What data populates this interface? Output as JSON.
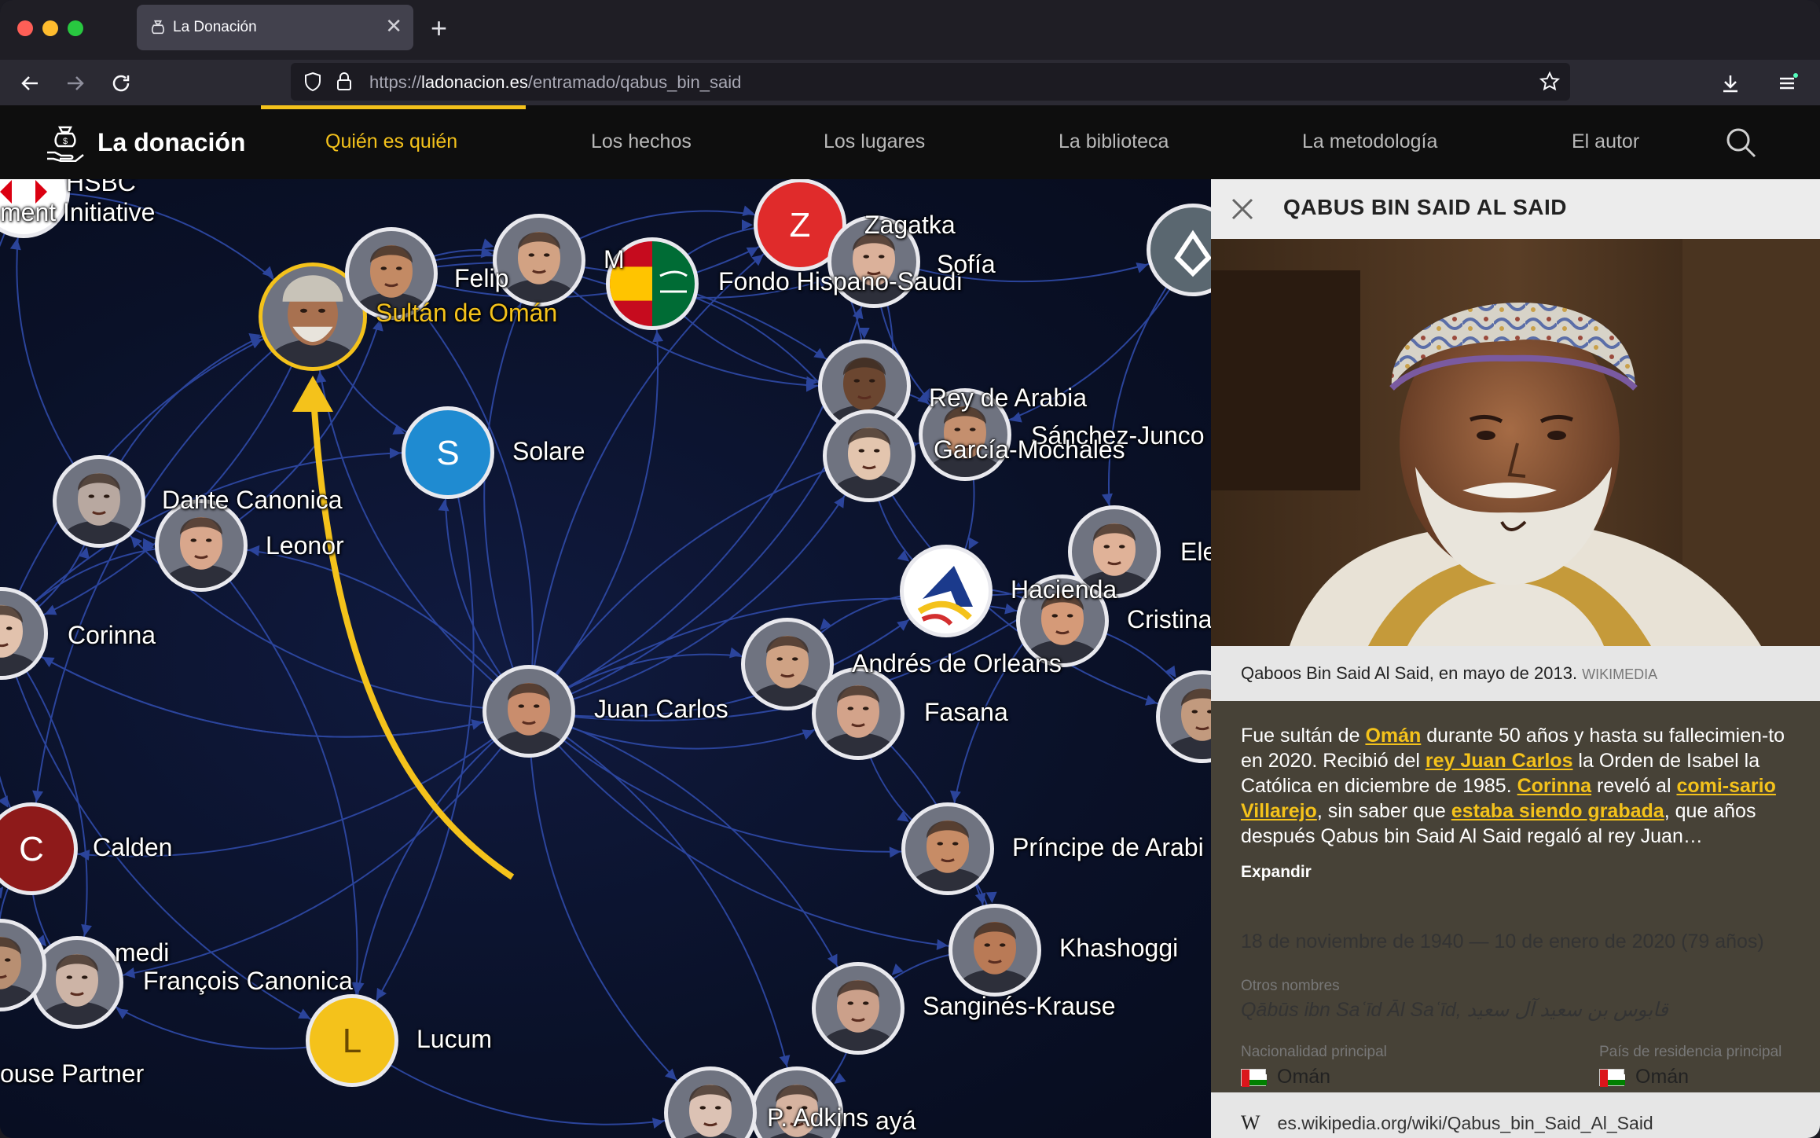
{
  "browser": {
    "tab_title": "La Donación",
    "tab_close": "✕",
    "new_tab": "+",
    "url_prefix": "https://",
    "url_domain": "ladonacion.es",
    "url_path": "/entramado/qabus_bin_said"
  },
  "site": {
    "brand": "La donación",
    "menu": [
      {
        "label": "Quién es quién",
        "active": true
      },
      {
        "label": "Los hechos"
      },
      {
        "label": "Los lugares"
      },
      {
        "label": "La biblioteca"
      },
      {
        "label": "La metodología"
      },
      {
        "label": "El autor"
      }
    ]
  },
  "graph": {
    "nodes": [
      {
        "label": "Sultán de Omán",
        "highlight": true
      },
      {
        "label": "Felip"
      },
      {
        "label": "M"
      },
      {
        "label": "Zagatka"
      },
      {
        "label": "Fondo Hispano-Saudí"
      },
      {
        "label": "Sofía"
      },
      {
        "label": "Solare",
        "initial": "S"
      },
      {
        "label": "Rey de Arabia"
      },
      {
        "label": "Sánchez-Junco"
      },
      {
        "label": "García-Mochales"
      },
      {
        "label": "Dante Canonica"
      },
      {
        "label": "Leonor"
      },
      {
        "label": "Corinna"
      },
      {
        "label": "Hacienda"
      },
      {
        "label": "Cristina"
      },
      {
        "label": "Ele"
      },
      {
        "label": "Andrés de Orleans"
      },
      {
        "label": "Juan Carlos"
      },
      {
        "label": "Fasana"
      },
      {
        "label": "Calden",
        "initial": "C"
      },
      {
        "label": "Príncipe de Arabi"
      },
      {
        "label": "medi"
      },
      {
        "label": "François Canonica"
      },
      {
        "label": "Khashoggi"
      },
      {
        "label": "Sanginés-Krause"
      },
      {
        "label": "Lucum",
        "initial": "L"
      },
      {
        "label": "ouse Partner"
      },
      {
        "label": "P. Adkins"
      },
      {
        "label": "ayá"
      },
      {
        "label": "HSBC"
      },
      {
        "label": "ment Initiative"
      },
      {
        "label": "Z"
      }
    ]
  },
  "panel": {
    "title": "QABUS BIN SAID AL SAID",
    "caption": "Qaboos Bin Said Al Said, en mayo de 2013.",
    "caption_source": "WIKIMEDIA",
    "bio": {
      "t1": "Fue sultán de ",
      "l1": "Omán",
      "t2": " durante 50 años y hasta su fallecimien-to en 2020. Recibió del ",
      "l2": "rey Juan Carlos",
      "t3": " la Orden de Isabel la Católica en diciembre de 1985. ",
      "l3": "Corinna",
      "t4": " reveló al ",
      "l4": "comi-sario Villarejo",
      "t5": ", sin saber que ",
      "l5": "estaba siendo grabada",
      "t6": ", que años después Qabus bin Said Al Said regaló al rey Juan…"
    },
    "expand": "Expandir",
    "dates": "18 de noviembre de 1940 — 10 de enero de 2020 (79 años)",
    "other_names_label": "Otros nombres",
    "other_names": "Qābūs ibn Saʿīd Āl Saʿīd, قابوس بن سعيد آل سعيد",
    "nationality_label": "Nacionalidad principal",
    "nationality": "Omán",
    "residence_label": "País de residencia principal",
    "residence": "Omán",
    "wiki_glyph": "W",
    "wiki_url": "es.wikipedia.org/wiki/Qabus_bin_Said_Al_Said"
  },
  "colors": {
    "accent": "#f4c21b",
    "graph_bg": "#0a1128",
    "edge": "#2f4aa8",
    "bio_bg": "#474237"
  }
}
